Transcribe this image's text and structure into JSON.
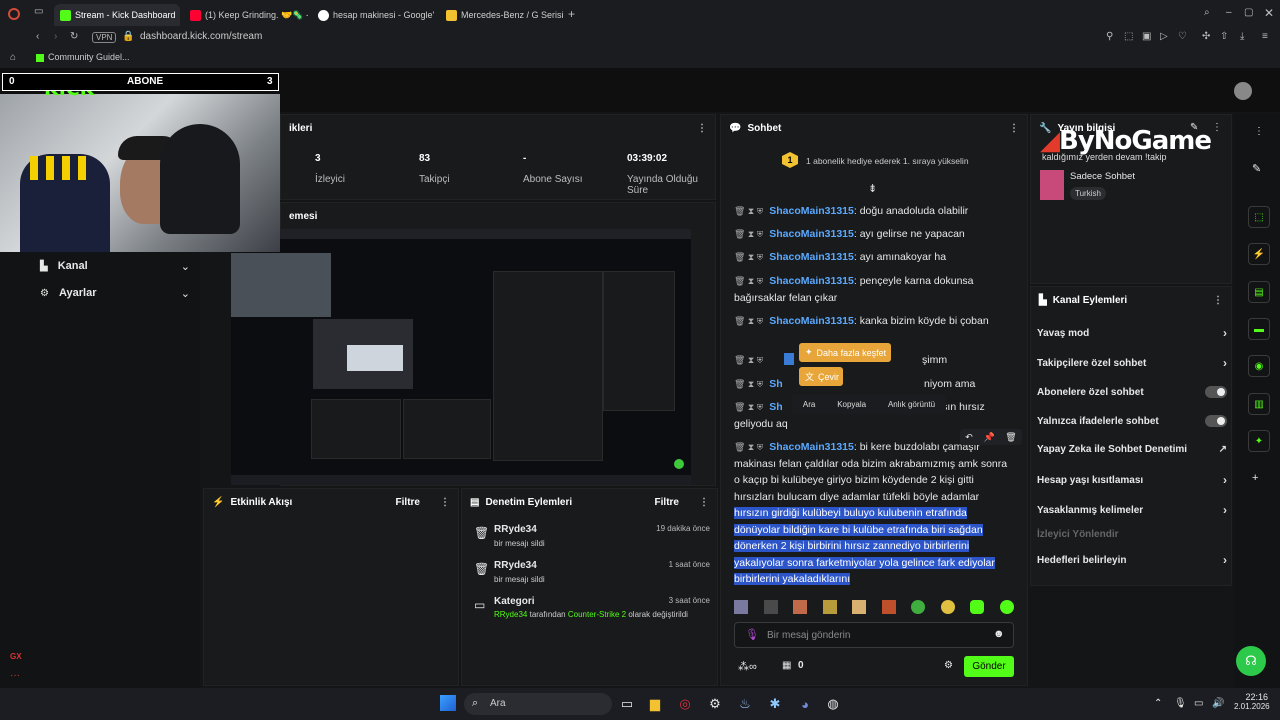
{
  "browser": {
    "tabs": [
      {
        "label": "Stream - Kick Dashboard",
        "color": "#53fc18"
      },
      {
        "label": "(1) Keep Grinding. 🤝🦠 -",
        "color": "#ff0033"
      },
      {
        "label": "hesap makinesi - Google'",
        "color": "#4285f4"
      },
      {
        "label": "Mercedes-Benz / G Serisi",
        "color": "#f2c230"
      }
    ],
    "vpn": "VPN",
    "url": "dashboard.kick.com/stream",
    "bookmark": "Community Guidel..."
  },
  "overlay": {
    "left_number": "0",
    "label": "ABONE",
    "right_number": "3",
    "kick_text": "KICK",
    "bynogame": "ByNoGame"
  },
  "stats": {
    "title": "ikleri",
    "items": [
      {
        "value": "3",
        "label": "İzleyici"
      },
      {
        "value": "83",
        "label": "Takipçi"
      },
      {
        "value": "-",
        "label": "Abone Sayısı"
      },
      {
        "value": "03:39:02",
        "label": "Yayında Olduğu Süre"
      }
    ]
  },
  "preview": {
    "title": "emesi"
  },
  "leftnav": {
    "items": [
      {
        "label": "Kanal"
      },
      {
        "label": "Ayarlar"
      }
    ]
  },
  "activity": {
    "title": "Etkinlik Akışı",
    "filter": "Filtre"
  },
  "audit": {
    "title": "Denetim Eylemleri",
    "filter": "Filtre",
    "items": [
      {
        "user": "RRyde34",
        "desc": "bir mesajı sildi",
        "time": "19 dakika önce"
      },
      {
        "user": "RRyde34",
        "desc": "bir mesajı sildi",
        "time": "1 saat önce"
      },
      {
        "user": "Kategori",
        "desc_user": "RRyde34",
        "desc_mid": "tarafından",
        "desc_game": "Counter-Strike 2",
        "desc_end": "olarak değiştirildi",
        "time": "3 saat önce"
      }
    ]
  },
  "chat": {
    "title": "Sohbet",
    "gift_count": "1",
    "gift_text": "1 abonelik hediye ederek 1. sıraya yükselin",
    "messages": [
      {
        "user": "ShacoMain31315",
        "text": ": doğu anadoluda olabilir"
      },
      {
        "user": "ShacoMain31315",
        "text": ": ayı gelirse ne yapacan"
      },
      {
        "user": "ShacoMain31315",
        "text": ": ayı amınakoyar ha"
      },
      {
        "user": "ShacoMain31315",
        "text": ": pençeyle karna dokunsa bağırsaklar felan çıkar"
      },
      {
        "user": "ShacoMain31315",
        "text": ": kanka bizim köyde bi çoban köpe"
      },
      {
        "partial": "şimm"
      },
      {
        "partial": "niyom ama"
      },
      {
        "partial": "kışın hırsız geliyodu aq"
      },
      {
        "user": "ShacoMain31315",
        "text": ": bi kere buzdolabı çamaşır makinası felan çaldılar oda bizim akrabamızmış amk sonra o kaçıp bi kulübeye giriyo bizim köydende 2 kişi gitti hırsızları bulucam diye adamlar tüfekli böyle adamlar",
        "selected": "hırsızın girdiği kulübeyi buluyo kulubenin etrafında dönüyolar bildiğin kare bi kulübe etrafında biri sağdan dönerken 2 kişi birbirini hırsız zannediyo birbirlerini yakalıyolar sonra farketmiyolar yola gelince fark ediyolar birbirlerini yakaladıklarını"
      }
    ],
    "popup": {
      "explore": "Daha fazla keşfet",
      "translate": "Çevir",
      "search": "Ara",
      "copy": "Kopyala",
      "screenshot": "Anlık görüntü"
    },
    "input_placeholder": "Bir mesaj gönderin",
    "counter": "0",
    "send": "Gönder"
  },
  "stream_info": {
    "title": "Yayın bilgisi",
    "stream_title": "kaldığımız yerden devam !takip",
    "category": "Sadece Sohbet",
    "tag": "Turkish"
  },
  "channel_actions": {
    "title": "Kanal Eylemleri",
    "items": [
      {
        "label": "Yavaş mod",
        "control": "chevron"
      },
      {
        "label": "Takipçilere özel sohbet",
        "control": "chevron"
      },
      {
        "label": "Abonelere özel sohbet",
        "control": "toggle"
      },
      {
        "label": "Yalnızca ifadelerle sohbet",
        "control": "toggle"
      },
      {
        "label": "Yapay Zeka ile Sohbet Denetimi",
        "control": "external"
      },
      {
        "label": "Hesap yaşı kısıtlaması",
        "control": "chevron"
      },
      {
        "label": "Yasaklanmış kelimeler",
        "control": "chevron"
      },
      {
        "label": "İzleyici Yönlendir",
        "control": "none"
      },
      {
        "label": "Hedefleri belirleyin",
        "control": "chevron"
      }
    ]
  },
  "taskbar": {
    "search": "Ara",
    "time": "22:16",
    "date": "2.01.2026"
  },
  "misc": {
    "gx": "GX"
  }
}
